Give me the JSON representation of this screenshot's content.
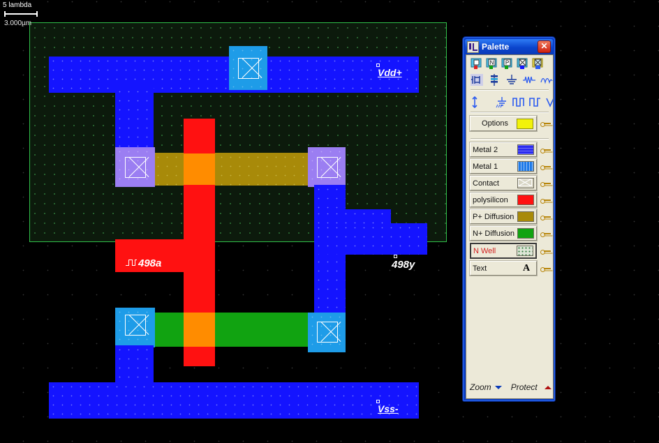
{
  "app": {
    "title": "Palette",
    "close_label": "✕"
  },
  "ruler": {
    "lambda_label": "5 lambda",
    "micron_label": "3.000µm"
  },
  "layout": {
    "labels": {
      "vdd": "Vdd+",
      "vss": "Vss-",
      "input": "498a",
      "output": "498y"
    }
  },
  "palette": {
    "options_label": "Options",
    "tool_icons_row1": [
      "contact-icon",
      "n-diffusion-icon",
      "p-diffusion-icon",
      "via-icon",
      "via2-icon"
    ],
    "tool_icons_row2": [
      "mos-device-icon",
      "capacitor-icon",
      "ground-icon",
      "pulse-signal-icon",
      "sine-signal-icon"
    ],
    "tool_icons_row3": [
      "vdd-supply-icon",
      "vss-ground-icon",
      "clock-icon",
      "pulse-icon",
      "analog-icon",
      "eye-icon"
    ],
    "layers": [
      {
        "name": "Metal 2",
        "icon": "metal2-swatch",
        "color": "#2b2bf0",
        "selected": false
      },
      {
        "name": "Metal 1",
        "icon": "metal1-swatch",
        "color": "#1e7ae8",
        "selected": false
      },
      {
        "name": "Contact",
        "icon": "contact-swatch",
        "color": "#d8d5c4",
        "selected": false
      },
      {
        "name": "polysilicon",
        "icon": "poly-swatch",
        "color": "#ff1111",
        "selected": false
      },
      {
        "name": "P+ Diffusion",
        "icon": "pdiff-swatch",
        "color": "#a88a09",
        "selected": false
      },
      {
        "name": "N+ Diffusion",
        "icon": "ndiff-swatch",
        "color": "#11a311",
        "selected": false
      },
      {
        "name": "N Well",
        "icon": "nwell-swatch",
        "color": "#c9d6c2",
        "selected": true
      },
      {
        "name": "Text",
        "icon": "text-swatch",
        "color": "#000000",
        "selected": false
      }
    ],
    "footer": {
      "zoom_label": "Zoom",
      "protect_label": "Protect"
    }
  },
  "colors": {
    "metal1": "#1414ff",
    "metal2": "#2b2bf0",
    "poly": "#ff1111",
    "gate": "#ff8c00",
    "pdiff": "#a88a09",
    "ndiff": "#11a311",
    "nwell_outline": "#31c04a",
    "contact": "#1e9ce8",
    "nwell_box": "#9b7ef2",
    "background": "#000000"
  }
}
